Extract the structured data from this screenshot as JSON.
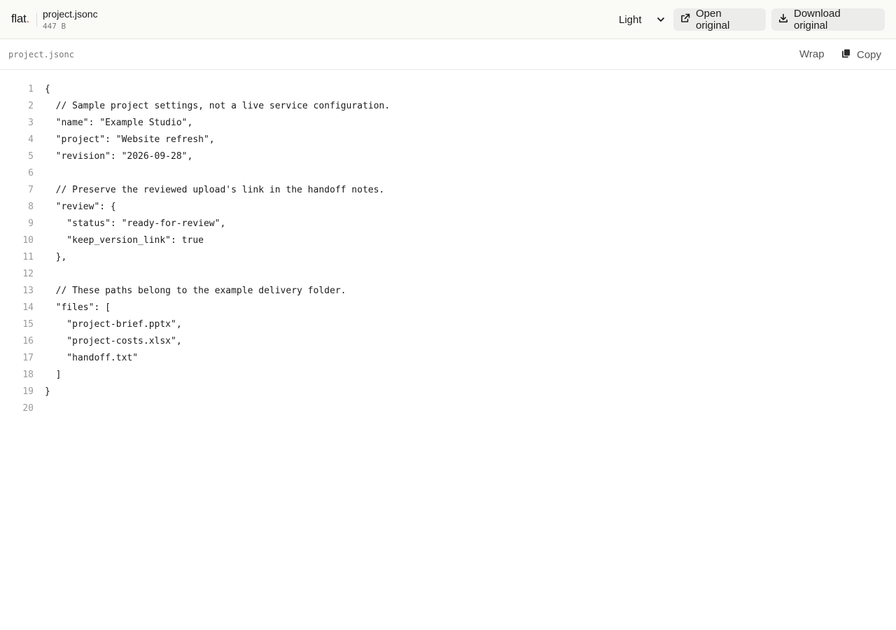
{
  "header": {
    "logo_text": "flat",
    "logo_dot": ".",
    "file_name": "project.jsonc",
    "file_size": "447 B",
    "theme_value": "Light",
    "open_label": "Open original",
    "download_label": "Download original"
  },
  "toolbar": {
    "path": "project.jsonc",
    "wrap_label": "Wrap",
    "copy_label": "Copy"
  },
  "code_lines": [
    {
      "n": "1",
      "text": "{"
    },
    {
      "n": "2",
      "text": "  // Sample project settings, not a live service configuration."
    },
    {
      "n": "3",
      "text": "  \"name\": \"Example Studio\","
    },
    {
      "n": "4",
      "text": "  \"project\": \"Website refresh\","
    },
    {
      "n": "5",
      "text": "  \"revision\": \"2026-09-28\","
    },
    {
      "n": "6",
      "text": ""
    },
    {
      "n": "7",
      "text": "  // Preserve the reviewed upload's link in the handoff notes."
    },
    {
      "n": "8",
      "text": "  \"review\": {"
    },
    {
      "n": "9",
      "text": "    \"status\": \"ready-for-review\","
    },
    {
      "n": "10",
      "text": "    \"keep_version_link\": true"
    },
    {
      "n": "11",
      "text": "  },"
    },
    {
      "n": "12",
      "text": ""
    },
    {
      "n": "13",
      "text": "  // These paths belong to the example delivery folder."
    },
    {
      "n": "14",
      "text": "  \"files\": ["
    },
    {
      "n": "15",
      "text": "    \"project-brief.pptx\","
    },
    {
      "n": "16",
      "text": "    \"project-costs.xlsx\","
    },
    {
      "n": "17",
      "text": "    \"handoff.txt\""
    },
    {
      "n": "18",
      "text": "  ]"
    },
    {
      "n": "19",
      "text": "}"
    },
    {
      "n": "20",
      "text": ""
    }
  ],
  "colors": {
    "accent_dot": "#e0482f",
    "header_bg": "#fafaf7",
    "button_bg": "#ececea"
  },
  "icons": {
    "theme": "chevron-down-icon",
    "open": "external-link-icon",
    "download": "download-icon",
    "copy": "copy-icon"
  }
}
